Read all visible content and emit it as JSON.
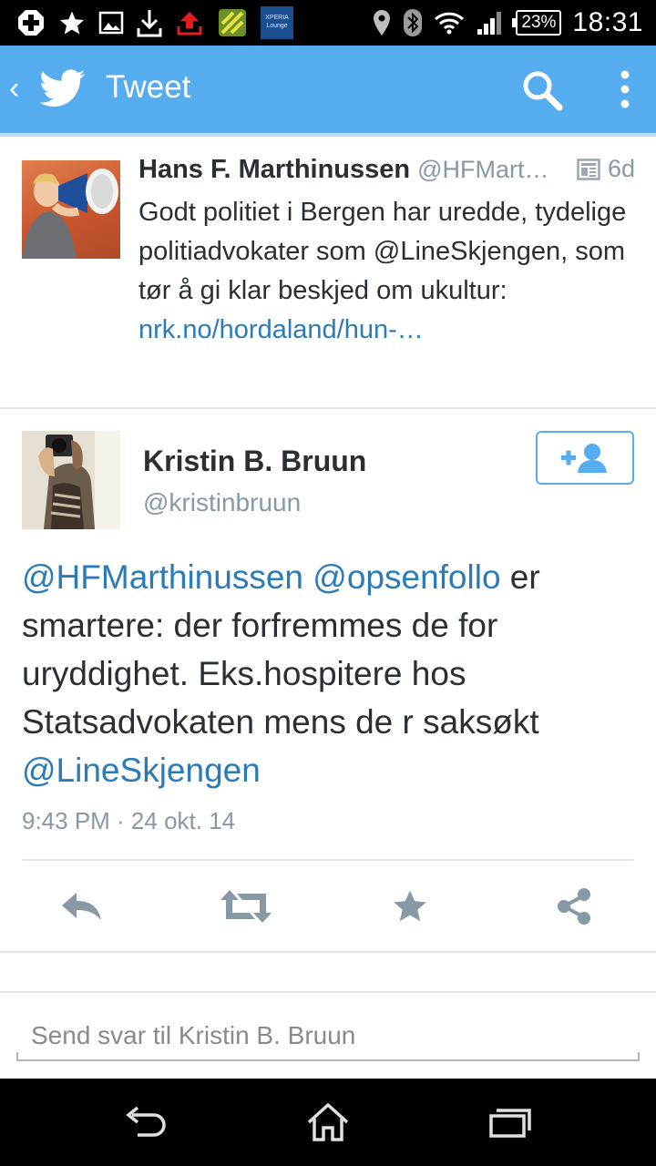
{
  "status_bar": {
    "xperia_label": "XPERIA Lounge",
    "battery": "23%",
    "time": "18:31"
  },
  "action_bar": {
    "title": "Tweet",
    "color": "#55acee"
  },
  "parent_tweet": {
    "name": "Hans F. Marthinussen",
    "handle": "@HFMart…",
    "age": "6d",
    "text_plain": "Godt politiet i Bergen har uredde, tydelige politiadvokater som @LineSkjengen, som tør å gi klar beskjed om ukultur: ",
    "link": "nrk.no/hordaland/hun-…"
  },
  "main_tweet": {
    "name": "Kristin B. Bruun",
    "handle": "@kristinbruun",
    "mention1": "@HFMarthinussen",
    "mention2": "@opsenfollo",
    "body": " er smartere: der forfremmes de for uryddighet. Eks.hospitere hos Statsadvokaten mens de r saksøkt ",
    "mention3": "@LineSkjengen",
    "timestamp": "9:43 PM · 24 okt. 14"
  },
  "actions": [
    "reply-icon",
    "retweet-icon",
    "favorite-icon",
    "share-icon"
  ],
  "reply": {
    "placeholder": "Send svar til Kristin B. Bruun"
  },
  "colors": {
    "accent": "#55acee",
    "link": "#2b7bb9",
    "text": "#292f33",
    "muted": "#8899a6"
  }
}
